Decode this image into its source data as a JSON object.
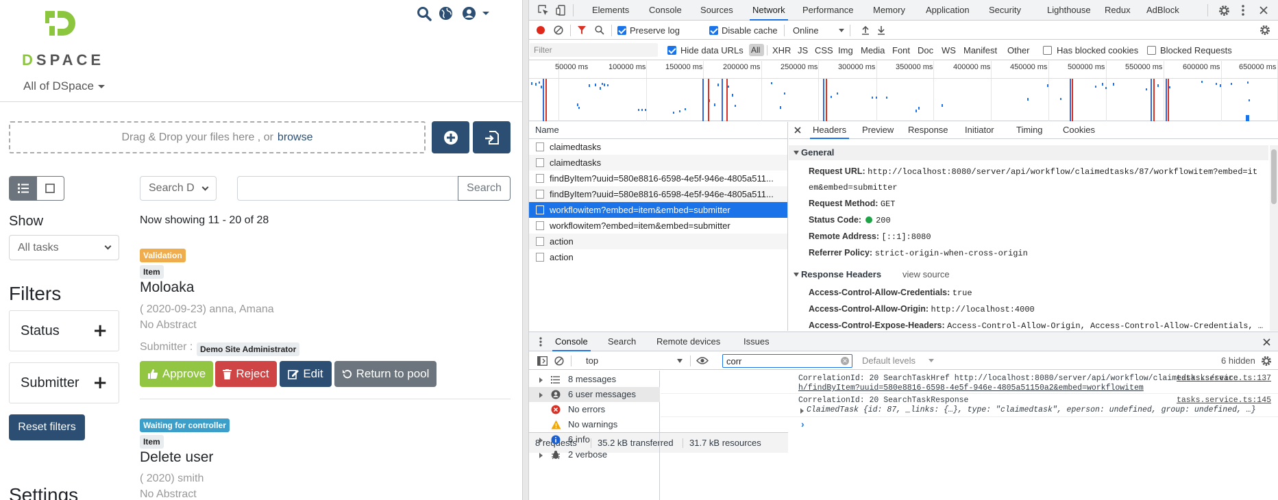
{
  "app": {
    "logo_text": "DSPACE",
    "community_select": "All of DSpace",
    "dropzone": {
      "text": "Drag & Drop your files here , or",
      "link": "browse"
    },
    "show_label": "Show",
    "show_select": "All tasks",
    "search_scope": "Search D",
    "search_button": "Search",
    "search_value": "",
    "now_showing": "Now showing 11 - 20 of 28",
    "filters_title": "Filters",
    "filters": [
      "Status",
      "Submitter"
    ],
    "reset_filters": "Reset filters",
    "settings_title": "Settings",
    "results": [
      {
        "status_badge": "Validation",
        "type_badge": "Item",
        "title": "Moloaka",
        "meta": "( 2020-09-23) anna, Amana",
        "abstract": "No Abstract",
        "submitter_label": "Submitter :",
        "submitter": "Demo Site Administrator",
        "actions": [
          "Approve",
          "Reject",
          "Edit",
          "Return to pool"
        ]
      },
      {
        "status_badge": "Waiting for controller",
        "type_badge": "Item",
        "title": "Delete user",
        "meta": "( 2020) smith",
        "abstract": "No Abstract"
      }
    ],
    "colors": {
      "primary": "#2b4e72",
      "success": "#92c642",
      "danger": "#cf4444",
      "secondary": "#6c757d",
      "warning": "#f0ad4e",
      "info": "#3b9fca"
    }
  },
  "devtools": {
    "tabs": [
      "Elements",
      "Console",
      "Sources",
      "Network",
      "Performance",
      "Memory",
      "Application",
      "Security",
      "Lighthouse",
      "Redux",
      "AdBlock"
    ],
    "active_tab": "Network",
    "toolbar": {
      "preserve_log": "Preserve log",
      "disable_cache": "Disable cache",
      "throttle": "Online"
    },
    "filter_bar": {
      "placeholder": "Filter",
      "hide_data_urls": "Hide data URLs",
      "types": [
        "All",
        "XHR",
        "JS",
        "CSS",
        "Img",
        "Media",
        "Font",
        "Doc",
        "WS",
        "Manifest",
        "Other"
      ],
      "blocked_cookies": "Has blocked cookies",
      "blocked_requests": "Blocked Requests"
    },
    "timeline_ticks": [
      "50000 ms",
      "100000 ms",
      "150000 ms",
      "200000 ms",
      "250000 ms",
      "300000 ms",
      "350000 ms",
      "400000 ms",
      "450000 ms",
      "500000 ms",
      "550000 ms",
      "600000 ms",
      "650000 ms"
    ],
    "requests_header": "Name",
    "requests": [
      "claimedtasks",
      "claimedtasks",
      "findByItem?uuid=580e8816-6598-4e5f-946e-4805a511...",
      "findByItem?uuid=580e8816-6598-4e5f-946e-4805a511...",
      "workflowitem?embed=item&embed=submitter",
      "workflowitem?embed=item&embed=submitter",
      "action",
      "action"
    ],
    "selected_request": 4,
    "summary": {
      "requests": "8 requests",
      "transferred": "35.2 kB transferred",
      "resources": "31.7 kB resources"
    },
    "detail_tabs": [
      "Headers",
      "Preview",
      "Response",
      "Initiator",
      "Timing",
      "Cookies"
    ],
    "general_title": "General",
    "general": [
      {
        "k": "Request URL:",
        "v": "http://localhost:8080/server/api/workflow/claimedtasks/87/workflowitem?embed=it"
      },
      {
        "k": "",
        "v": "em&embed=submitter"
      },
      {
        "k": "Request Method:",
        "v": "GET"
      },
      {
        "k": "Status Code:",
        "v": "200"
      },
      {
        "k": "Remote Address:",
        "v": "[::1]:8080"
      },
      {
        "k": "Referrer Policy:",
        "v": "strict-origin-when-cross-origin"
      }
    ],
    "response_headers_title": "Response Headers",
    "view_source": "view source",
    "response_headers": [
      {
        "k": "Access-Control-Allow-Credentials:",
        "v": "true"
      },
      {
        "k": "Access-Control-Allow-Origin:",
        "v": "http://localhost:4000"
      },
      {
        "k": "Access-Control-Expose-Headers:",
        "v": "Access-Control-Allow-Origin, Access-Control-Allow-Credentials, …"
      }
    ],
    "drawer_tabs": [
      "Console",
      "Search",
      "Remote devices",
      "Issues"
    ],
    "console": {
      "context": "top",
      "filter_value": "corr",
      "levels": "Default levels",
      "hidden": "6 hidden",
      "sidebar": [
        "8 messages",
        "6 user messages",
        "No errors",
        "No warnings",
        "6 info",
        "2 verbose"
      ],
      "logs": [
        {
          "line1": "CorrelationId: 20 SearchTaskHref http://localhost:8080/server/api/workflow/claimedtasks/searc",
          "line2": "h/findByItem?uuid=580e8816-6598-4e5f-946e-4805a51150a2&embed=workflowitem",
          "source": "tasks.service.ts:137"
        },
        {
          "line1": "CorrelationId: 20 SearchTaskResponse",
          "line2": "ClaimedTask {id: 87, _links: {…}, type: \"claimedtask\", eperson: undefined, group: undefined, …}",
          "source": "tasks.service.ts:145"
        }
      ]
    }
  }
}
